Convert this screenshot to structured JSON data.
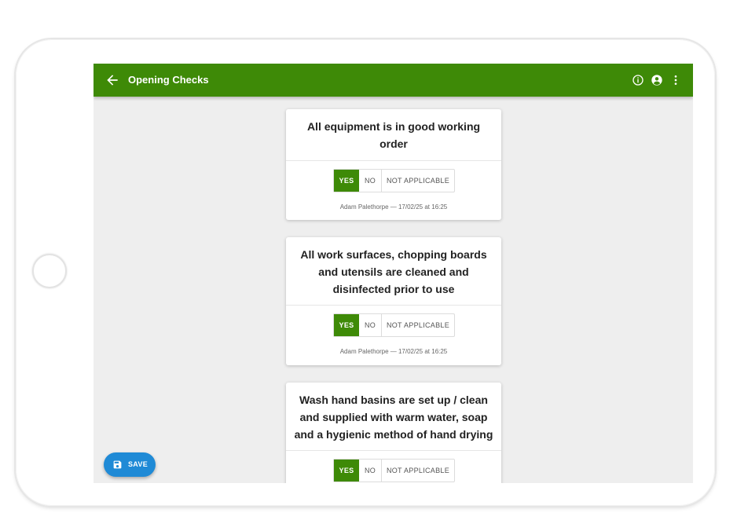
{
  "header": {
    "title": "Opening Checks"
  },
  "checks": [
    {
      "question": "All equipment is in good working order",
      "options": [
        "YES",
        "NO",
        "NOT APPLICABLE"
      ],
      "selected": "YES",
      "meta": "Adam Palethorpe — 17/02/25 at 16:25"
    },
    {
      "question": "All work surfaces, chopping boards and utensils are cleaned and disinfected prior to use",
      "options": [
        "YES",
        "NO",
        "NOT APPLICABLE"
      ],
      "selected": "YES",
      "meta": "Adam Palethorpe — 17/02/25 at 16:25"
    },
    {
      "question": "Wash hand basins are set up / clean and supplied with warm water, soap and a hygienic method of hand drying",
      "options": [
        "YES",
        "NO",
        "NOT APPLICABLE"
      ],
      "selected": "YES"
    }
  ],
  "fab": {
    "label": "SAVE"
  },
  "colors": {
    "appbar": "#3e8a07",
    "selected": "#3e8a07",
    "fab": "#1f8ad6"
  },
  "icons": {
    "back": "arrow-left-icon",
    "info": "info-icon",
    "account": "account-icon",
    "menu": "more-vert-icon",
    "save": "floppy-disk-icon"
  }
}
